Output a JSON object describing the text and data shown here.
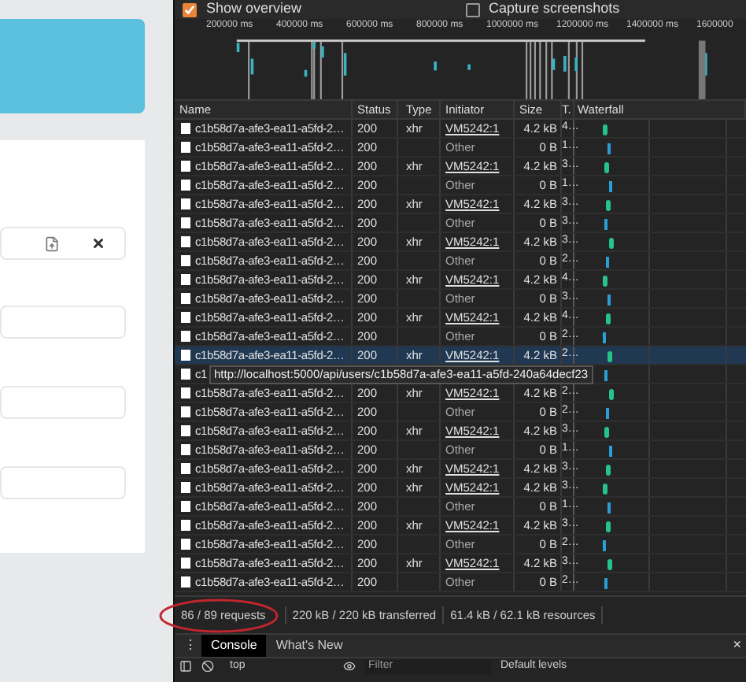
{
  "page": {
    "fields": [
      {
        "kind": "file"
      },
      {
        "kind": "text"
      },
      {
        "kind": "text"
      },
      {
        "kind": "text"
      }
    ]
  },
  "overview_options": [
    {
      "label": "Show overview",
      "checked": true
    },
    {
      "label": "Capture screenshots",
      "checked": false
    }
  ],
  "timeline_ticks": [
    "200000 ms",
    "400000 ms",
    "600000 ms",
    "800000 ms",
    "1000000 ms",
    "1200000 ms",
    "1400000 ms",
    "1600000"
  ],
  "table": {
    "columns": [
      "Name",
      "Status",
      "Type",
      "Initiator",
      "Size",
      "T.",
      "Waterfall"
    ],
    "rows": [
      {
        "name": "c1b58d7a-afe3-ea11-a5fd-2…",
        "status": "200",
        "kind": "xhr",
        "type": "xhr",
        "initiator": "VM5242:1",
        "size": "4.2 kB",
        "time": "4…",
        "selected": false
      },
      {
        "name": "c1b58d7a-afe3-ea11-a5fd-2…",
        "status": "200",
        "kind": "other",
        "initiator": "Other",
        "size": "0 B",
        "time": "1…",
        "selected": false
      },
      {
        "name": "c1b58d7a-afe3-ea11-a5fd-2…",
        "status": "200",
        "kind": "xhr",
        "type": "xhr",
        "initiator": "VM5242:1",
        "size": "4.2 kB",
        "time": "3…",
        "selected": false
      },
      {
        "name": "c1b58d7a-afe3-ea11-a5fd-2…",
        "status": "200",
        "kind": "other",
        "initiator": "Other",
        "size": "0 B",
        "time": "1…",
        "selected": false
      },
      {
        "name": "c1b58d7a-afe3-ea11-a5fd-2…",
        "status": "200",
        "kind": "xhr",
        "type": "xhr",
        "initiator": "VM5242:1",
        "size": "4.2 kB",
        "time": "3…",
        "selected": false
      },
      {
        "name": "c1b58d7a-afe3-ea11-a5fd-2…",
        "status": "200",
        "kind": "other",
        "initiator": "Other",
        "size": "0 B",
        "time": "3…",
        "selected": false
      },
      {
        "name": "c1b58d7a-afe3-ea11-a5fd-2…",
        "status": "200",
        "kind": "xhr",
        "type": "xhr",
        "initiator": "VM5242:1",
        "size": "4.2 kB",
        "time": "3…",
        "selected": false
      },
      {
        "name": "c1b58d7a-afe3-ea11-a5fd-2…",
        "status": "200",
        "kind": "other",
        "initiator": "Other",
        "size": "0 B",
        "time": "2…",
        "selected": false
      },
      {
        "name": "c1b58d7a-afe3-ea11-a5fd-2…",
        "status": "200",
        "kind": "xhr",
        "type": "xhr",
        "initiator": "VM5242:1",
        "size": "4.2 kB",
        "time": "4…",
        "selected": false
      },
      {
        "name": "c1b58d7a-afe3-ea11-a5fd-2…",
        "status": "200",
        "kind": "other",
        "initiator": "Other",
        "size": "0 B",
        "time": "3…",
        "selected": false
      },
      {
        "name": "c1b58d7a-afe3-ea11-a5fd-2…",
        "status": "200",
        "kind": "xhr",
        "type": "xhr",
        "initiator": "VM5242:1",
        "size": "4.2 kB",
        "time": "4…",
        "selected": false
      },
      {
        "name": "c1b58d7a-afe3-ea11-a5fd-2…",
        "status": "200",
        "kind": "other",
        "initiator": "Other",
        "size": "0 B",
        "time": "2…",
        "selected": false
      },
      {
        "name": "c1b58d7a-afe3-ea11-a5fd-2…",
        "status": "200",
        "kind": "xhr",
        "type": "xhr",
        "initiator": "VM5242:1",
        "size": "4.2 kB",
        "time": "2…",
        "selected": true
      },
      {
        "name": "c1",
        "kind": "other",
        "tooltip": "http://localhost:5000/api/users/c1b58d7a-afe3-ea11-a5fd-240a64decf23",
        "selected": false
      },
      {
        "name": "c1b58d7a-afe3-ea11-a5fd-2…",
        "status": "200",
        "kind": "xhr",
        "type": "xhr",
        "initiator": "VM5242:1",
        "size": "4.2 kB",
        "time": "2…",
        "selected": false
      },
      {
        "name": "c1b58d7a-afe3-ea11-a5fd-2…",
        "status": "200",
        "kind": "other",
        "initiator": "Other",
        "size": "0 B",
        "time": "2…",
        "selected": false
      },
      {
        "name": "c1b58d7a-afe3-ea11-a5fd-2…",
        "status": "200",
        "kind": "xhr",
        "type": "xhr",
        "initiator": "VM5242:1",
        "size": "4.2 kB",
        "time": "3…",
        "selected": false
      },
      {
        "name": "c1b58d7a-afe3-ea11-a5fd-2…",
        "status": "200",
        "kind": "other",
        "initiator": "Other",
        "size": "0 B",
        "time": "1…",
        "selected": false
      },
      {
        "name": "c1b58d7a-afe3-ea11-a5fd-2…",
        "status": "200",
        "kind": "xhr",
        "type": "xhr",
        "initiator": "VM5242:1",
        "size": "4.2 kB",
        "time": "3…",
        "selected": false
      },
      {
        "name": "c1b58d7a-afe3-ea11-a5fd-2…",
        "status": "200",
        "kind": "xhr",
        "type": "xhr",
        "initiator": "VM5242:1",
        "size": "4.2 kB",
        "time": "3…",
        "selected": false
      },
      {
        "name": "c1b58d7a-afe3-ea11-a5fd-2…",
        "status": "200",
        "kind": "other",
        "initiator": "Other",
        "size": "0 B",
        "time": "1…",
        "selected": false
      },
      {
        "name": "c1b58d7a-afe3-ea11-a5fd-2…",
        "status": "200",
        "kind": "xhr",
        "type": "xhr",
        "initiator": "VM5242:1",
        "size": "4.2 kB",
        "time": "3…",
        "selected": false
      },
      {
        "name": "c1b58d7a-afe3-ea11-a5fd-2…",
        "status": "200",
        "kind": "other",
        "initiator": "Other",
        "size": "0 B",
        "time": "2…",
        "selected": false
      },
      {
        "name": "c1b58d7a-afe3-ea11-a5fd-2…",
        "status": "200",
        "kind": "xhr",
        "type": "xhr",
        "initiator": "VM5242:1",
        "size": "4.2 kB",
        "time": "3…",
        "selected": false
      },
      {
        "name": "c1b58d7a-afe3-ea11-a5fd-2…",
        "status": "200",
        "kind": "other",
        "initiator": "Other",
        "size": "0 B",
        "time": "2…",
        "selected": false
      }
    ]
  },
  "status_bar": [
    "86 / 89 requests",
    "220 kB / 220 kB transferred",
    "61.4 kB / 62.1 kB resources"
  ],
  "drawer": {
    "menu": "⋮",
    "tabs": [
      {
        "label": "Console",
        "selected": true
      },
      {
        "label": "What's New",
        "selected": false
      }
    ],
    "close": "×"
  },
  "console_toolbar": {
    "context": "top",
    "filter_placeholder": "Filter",
    "levels": "Default levels"
  }
}
